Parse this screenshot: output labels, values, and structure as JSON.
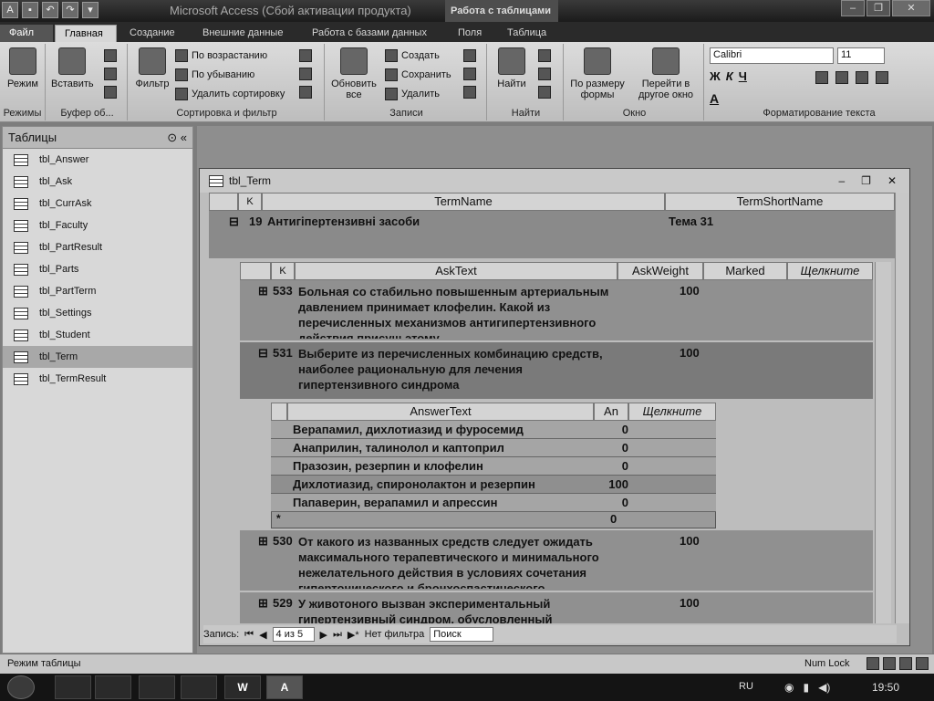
{
  "app": {
    "title": "Microsoft Access (Сбой активации продукта)",
    "context_title": "Работа с таблицами"
  },
  "tabs": [
    "Файл",
    "Главная",
    "Создание",
    "Внешние данные",
    "Работа с базами данных",
    "Поля",
    "Таблица"
  ],
  "ribbon": {
    "groups": {
      "views": "Режимы",
      "clipboard": "Буфер об...",
      "sort": "Сортировка и фильтр",
      "records": "Записи",
      "find": "Найти",
      "window": "Окно",
      "format": "Форматирование текста"
    },
    "view_btn": "Режим",
    "paste_btn": "Вставить",
    "filter_btn": "Фильтр",
    "sort_asc": "По возрастанию",
    "sort_desc": "По убыванию",
    "remove_sort": "Удалить сортировку",
    "refresh_btn": "Обновить все",
    "new_btn": "Создать",
    "save_btn": "Сохранить",
    "delete_btn": "Удалить",
    "find_btn": "Найти",
    "fit_btn": "По размеру формы",
    "switch_btn": "Перейти в другое окно",
    "font": "Calibri",
    "size": "11",
    "fmt_bold": "Ж",
    "fmt_italic": "К",
    "fmt_underline": "Ч",
    "fmt_color": "А"
  },
  "nav": {
    "header": "Таблицы",
    "items": [
      "tbl_Answer",
      "tbl_Ask",
      "tbl_CurrAsk",
      "tbl_Faculty",
      "tbl_PartResult",
      "tbl_Parts",
      "tbl_PartTerm",
      "tbl_Settings",
      "tbl_Student",
      "tbl_Term",
      "tbl_TermResult"
    ],
    "selected_index": 9
  },
  "doc": {
    "title": "tbl_Term",
    "term_headers": [
      "K",
      "TermName",
      "TermShortName"
    ],
    "term_row": {
      "id": "19",
      "name": "Антигіпертензивні засоби",
      "short": "Тема 31",
      "expander": "⊟"
    },
    "ask_headers": [
      "K",
      "AskText",
      "AskWeight",
      "Marked",
      "Щелкните"
    ],
    "asks": [
      {
        "id": "533",
        "text": "Больная со стабильно повышенным артериальным давлением принимает клофелин. Какой из перечисленных механизмов антигипертензивного действия присущ этому",
        "weight": "100",
        "expander": "⊞"
      },
      {
        "id": "531",
        "text": "Выберите из перечисленных комбинацию средств, наиболее рациональную для лечения гипертензивного синдрома",
        "weight": "100",
        "expander": "⊟"
      },
      {
        "id": "530",
        "text": "От какого из названных средств следует ожидать максимального терапевтического и минимального нежелательного действия в условиях сочетания гипертонического и бронхоспастического синдромов?",
        "weight": "100",
        "expander": "⊞"
      },
      {
        "id": "529",
        "text": "У животоного вызван экспериментальный гипертензивный синдром, обусловленный",
        "weight": "100",
        "expander": "⊞"
      }
    ],
    "answer_headers": [
      "AnswerText",
      "An",
      "Щелкните"
    ],
    "answers": [
      {
        "text": "Верапамил, дихлотиазид и фуросемид",
        "value": "0"
      },
      {
        "text": "Анаприлин, талинолол и каптоприл",
        "value": "0"
      },
      {
        "text": "Празозин, резерпин и клофелин",
        "value": "0"
      },
      {
        "text": "Дихлотиазид, спиронолактон и резерпин",
        "value": "100"
      },
      {
        "text": "Папаверин, верапамил и апрессин",
        "value": "0"
      }
    ],
    "new_row": {
      "marker": "*",
      "value": "0"
    },
    "recnav": {
      "label": "Запись:",
      "position": "4 из 5",
      "filter": "Нет фильтра",
      "search": "Поиск"
    }
  },
  "status": {
    "left": "Режим таблицы",
    "numlock": "Num Lock"
  },
  "taskbar": {
    "lang": "RU",
    "time": "19:50"
  }
}
